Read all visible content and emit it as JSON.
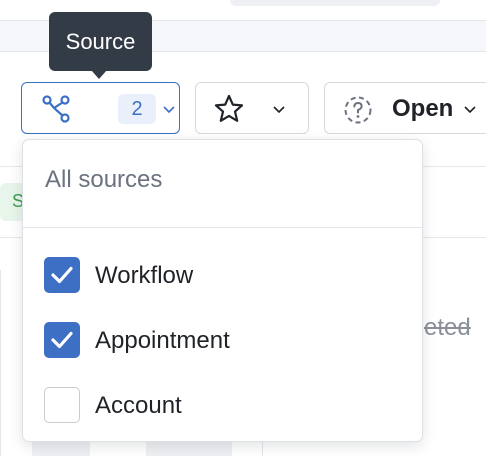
{
  "tooltip": {
    "text": "Source"
  },
  "toolbar": {
    "source_filter": {
      "selected_count": "2",
      "icon": "branch-nodes-icon"
    },
    "favorites_filter": {
      "icon": "star-icon"
    },
    "status_filter": {
      "label": "Open",
      "icon": "dashed-question-circle-icon"
    }
  },
  "dropdown": {
    "header": "All sources",
    "options": [
      {
        "label": "Workflow",
        "checked": true
      },
      {
        "label": "Appointment",
        "checked": true
      },
      {
        "label": "Account",
        "checked": false
      }
    ]
  },
  "background": {
    "chip_text": "S",
    "struck_text": "eted"
  },
  "colors": {
    "accent": "#3d6fc4",
    "tooltip_bg": "#333b46",
    "muted_text": "#6b7280"
  }
}
